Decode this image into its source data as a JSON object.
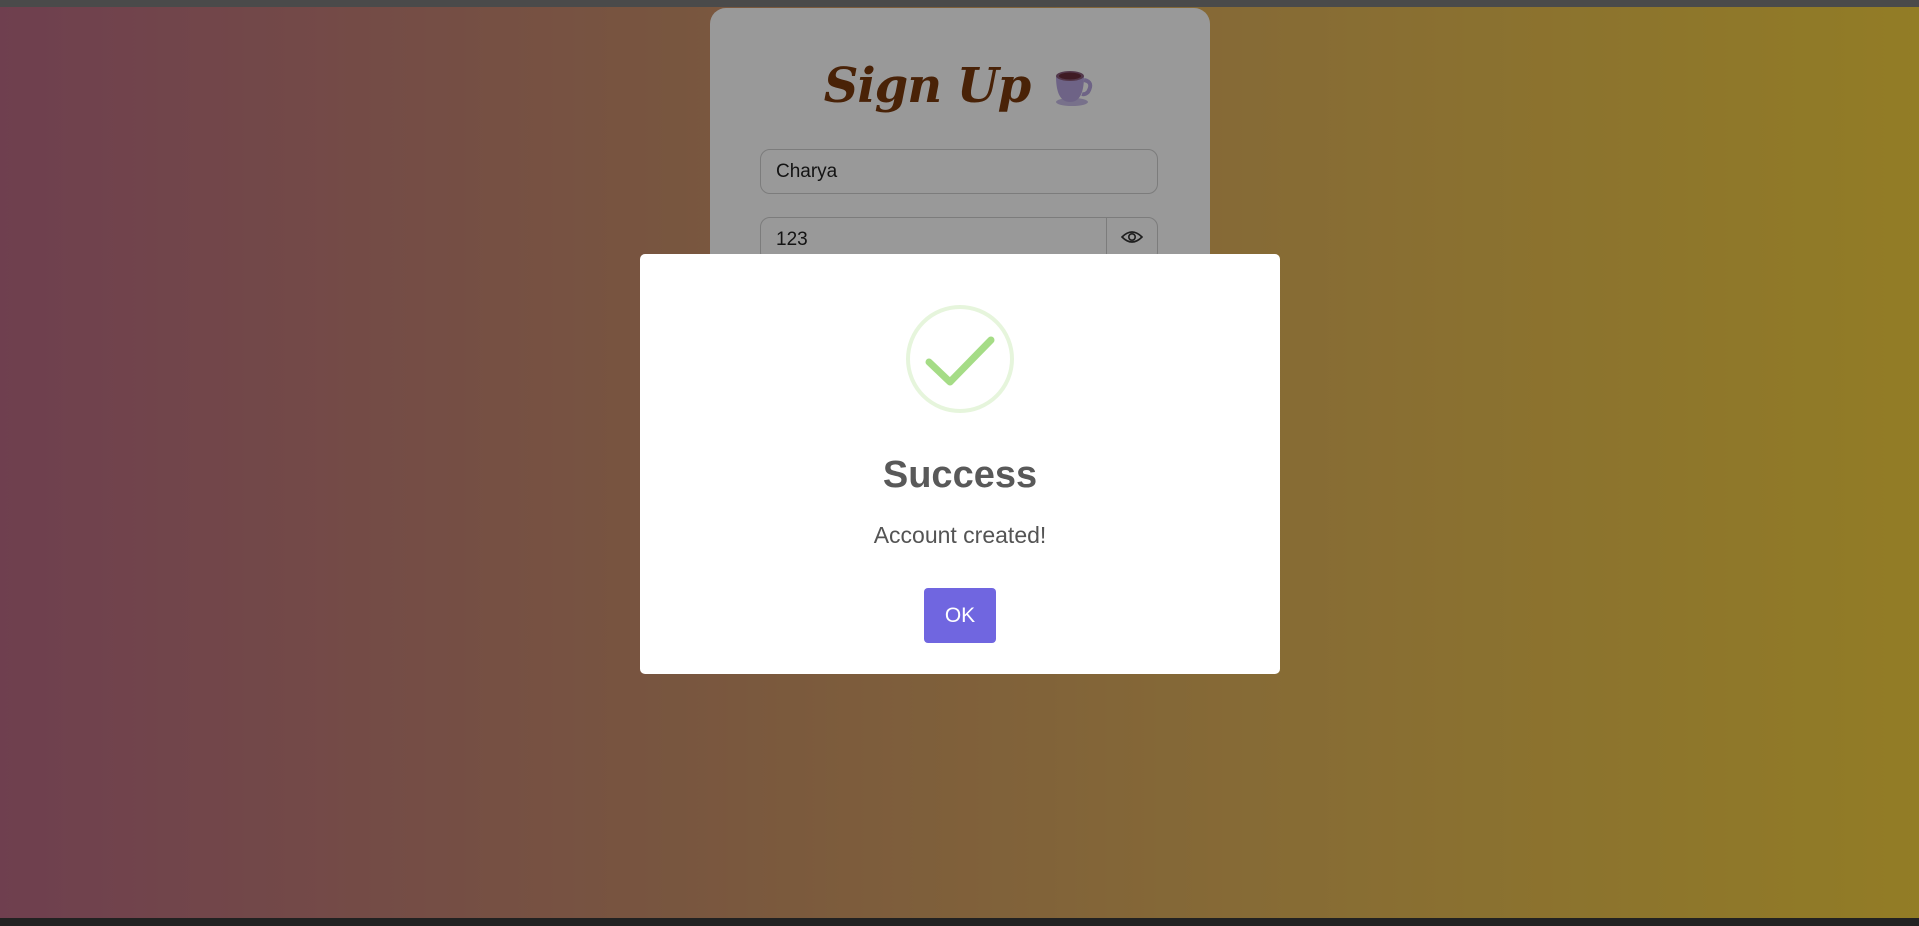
{
  "signup": {
    "title": "Sign Up",
    "title_icon": "tea-cup-icon",
    "username_value": "Charya",
    "password_value": "123",
    "password_toggle_icon": "eye-icon"
  },
  "modal": {
    "icon": "success-check-icon",
    "title": "Success",
    "message": "Account created!",
    "ok_label": "OK"
  },
  "colors": {
    "accent": "#7066e0",
    "success": "#a5dc86",
    "title_brown": "#7b3a0c"
  }
}
